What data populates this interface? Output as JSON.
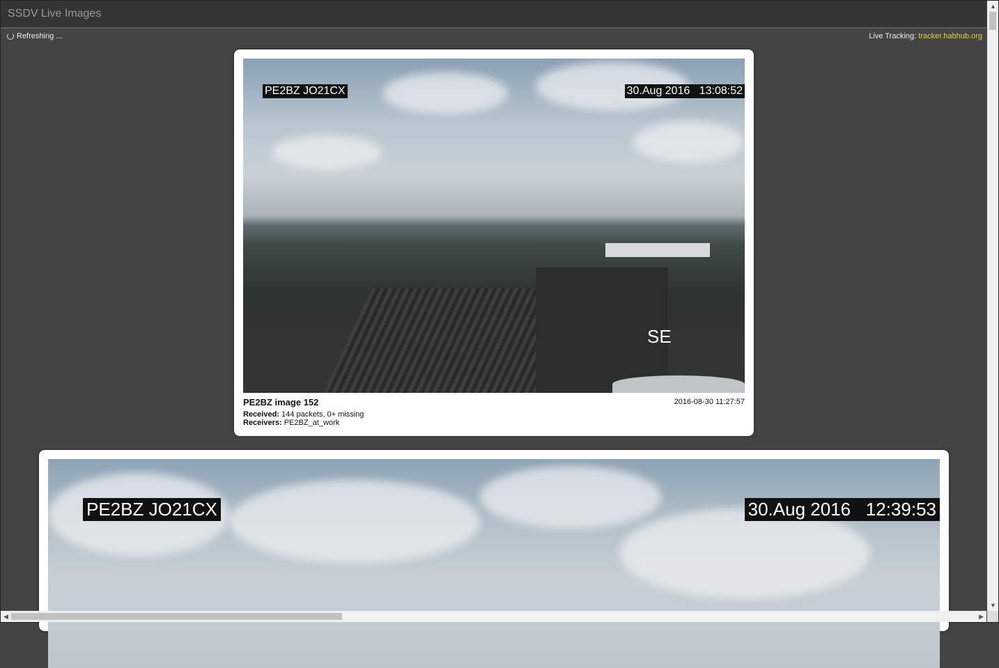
{
  "header": {
    "title": "SSDV Live Images"
  },
  "status": {
    "text": "Refreshing ...",
    "icon": "spinner-icon"
  },
  "tracking": {
    "label": "Live Tracking:",
    "link": "tracker.habhub.org"
  },
  "images": [
    {
      "overlay_callsign": "PE2BZ JO21CX",
      "overlay_datetime": "30.Aug 2016   13:08:52",
      "overlay_direction": "SE",
      "title": "PE2BZ image 152",
      "timestamp": "2016-08-30 11:27:57",
      "received_label": "Received:",
      "received_value": "144 packets, 0+ missing",
      "receivers_label": "Receivers:",
      "receivers_value": "PE2BZ_at_work"
    },
    {
      "overlay_callsign": "PE2BZ JO21CX",
      "overlay_datetime": "30.Aug 2016   12:39:53"
    }
  ]
}
